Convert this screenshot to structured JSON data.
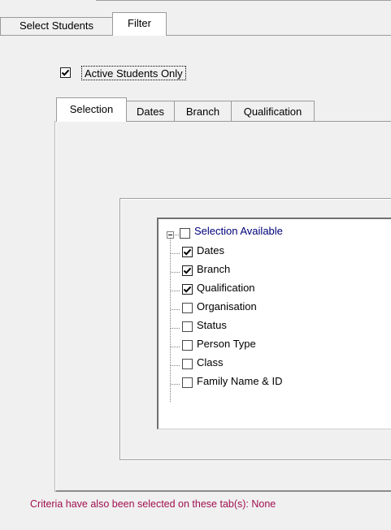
{
  "outer_tabs": [
    {
      "label": "Select Students",
      "active": false
    },
    {
      "label": "Filter",
      "active": true
    }
  ],
  "filter": {
    "active_only": {
      "label": "Active Students Only",
      "checked": true
    }
  },
  "inner_tabs": [
    {
      "label": "Selection",
      "active": true
    },
    {
      "label": "Dates",
      "active": false
    },
    {
      "label": "Branch",
      "active": false
    },
    {
      "label": "Qualification",
      "active": false
    }
  ],
  "tree": {
    "root": {
      "label": "Selection Available",
      "checked": false,
      "expanded": true
    },
    "items": [
      {
        "label": "Dates",
        "checked": true
      },
      {
        "label": "Branch",
        "checked": true
      },
      {
        "label": "Qualification",
        "checked": true
      },
      {
        "label": "Organisation",
        "checked": false
      },
      {
        "label": "Status",
        "checked": false
      },
      {
        "label": "Person Type",
        "checked": false
      },
      {
        "label": "Class",
        "checked": false
      },
      {
        "label": "Family Name & ID",
        "checked": false
      }
    ]
  },
  "status": {
    "text": "Criteria have also been selected on these tab(s): None",
    "color": "#a01050"
  }
}
